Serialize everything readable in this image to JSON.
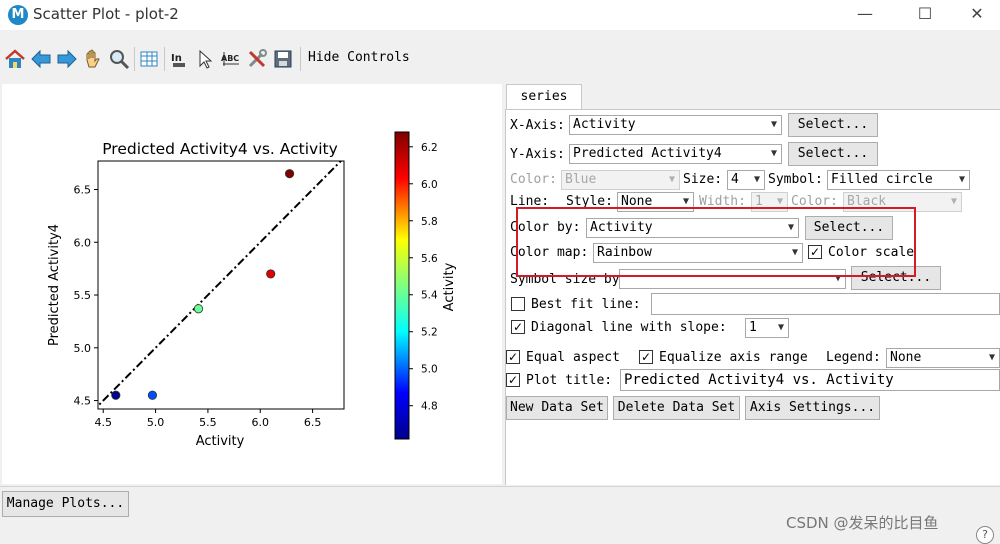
{
  "window": {
    "app_icon_letter": "M",
    "title": "Scatter Plot - plot-2",
    "minimize_glyph": "—",
    "maximize_glyph": "☐",
    "close_glyph": "✕"
  },
  "toolbar": {
    "icons": [
      "home-icon",
      "back-arrow-icon",
      "forward-arrow-icon",
      "pan-hand-icon",
      "zoom-icon",
      "table-icon",
      "import-icon",
      "select-pointer-icon",
      "label-abc-icon",
      "tools-icon",
      "save-icon"
    ],
    "import_icon_text": "In",
    "label_icon_text": "ABC",
    "hide_controls_label": "Hide Controls"
  },
  "tab": {
    "label": "series"
  },
  "controls": {
    "x_axis_label": "X-Axis:",
    "x_axis_value": "Activity",
    "x_select_label": "Select...",
    "y_axis_label": "Y-Axis:",
    "y_axis_value": "Predicted Activity4",
    "y_select_label": "Select...",
    "color_label": "Color:",
    "color_value": "Blue",
    "size_label": "Size:",
    "size_value": "4",
    "symbol_label": "Symbol:",
    "symbol_value": "Filled circle",
    "line_label": "Line:",
    "style_label": "Style:",
    "style_value": "None",
    "width_label": "Width:",
    "width_value": "1",
    "line_color_label": "Color:",
    "line_color_value": "Black",
    "color_by_label": "Color by:",
    "color_by_value": "Activity",
    "color_by_select_label": "Select...",
    "color_map_label": "Color map:",
    "color_map_value": "Rainbow",
    "color_scale_label": "Color scale",
    "color_scale_checked": true,
    "symbol_size_label": "Symbol size by:",
    "symbol_size_value": "",
    "symbol_size_select_label": "Select...",
    "best_fit_label": "Best fit line:",
    "best_fit_checked": false,
    "best_fit_value": "",
    "diagonal_label": "Diagonal line with slope:",
    "diagonal_checked": true,
    "diagonal_value": "1",
    "equal_aspect_label": "Equal aspect",
    "equal_aspect_checked": true,
    "equalize_label": "Equalize axis range",
    "equalize_checked": true,
    "legend_label": "Legend:",
    "legend_value": "None",
    "plot_title_label": "Plot title:",
    "plot_title_checked": true,
    "plot_title_value": "Predicted Activity4 vs. Activity",
    "new_data_set_label": "New Data Set",
    "delete_data_set_label": "Delete Data Set",
    "axis_settings_label": "Axis Settings..."
  },
  "check_glyph": "✓",
  "bottom": {
    "manage_plots_label": "Manage Plots...",
    "watermark": "CSDN @发呆的比目鱼",
    "help_glyph": "?"
  },
  "colors": {
    "highlight_box": "#d01c28",
    "diagonal_line": "#000000"
  },
  "chart_data": {
    "type": "scatter",
    "title": "Predicted Activity4 vs. Activity",
    "xlabel": "Activity",
    "ylabel": "Predicted Activity4",
    "xlim": [
      4.45,
      6.8
    ],
    "ylim": [
      4.42,
      6.77
    ],
    "xticks": [
      4.5,
      5.0,
      5.5,
      6.0,
      6.5
    ],
    "yticks": [
      4.5,
      5.0,
      5.5,
      6.0,
      6.5
    ],
    "tick_labels_x": [
      "4.5",
      "5.0",
      "5.5",
      "6.0",
      "6.5"
    ],
    "tick_labels_y": [
      "4.5",
      "5.0",
      "5.5",
      "6.0",
      "6.5"
    ],
    "points": [
      {
        "x": 4.62,
        "y": 4.55
      },
      {
        "x": 4.97,
        "y": 4.55
      },
      {
        "x": 5.41,
        "y": 5.37
      },
      {
        "x": 6.1,
        "y": 5.7
      },
      {
        "x": 6.28,
        "y": 6.65
      }
    ],
    "diagonal": {
      "slope": 1,
      "style": "dash-dot"
    },
    "colorbar": {
      "label": "Activity",
      "colormap": "rainbow",
      "range": [
        4.62,
        6.28
      ],
      "ticks": [
        4.8,
        5.0,
        5.2,
        5.4,
        5.6,
        5.8,
        6.0,
        6.2
      ],
      "tick_labels": [
        "4.8",
        "5.0",
        "5.2",
        "5.4",
        "5.6",
        "5.8",
        "6.0",
        "6.2"
      ]
    },
    "grid": false,
    "legend": "none"
  }
}
